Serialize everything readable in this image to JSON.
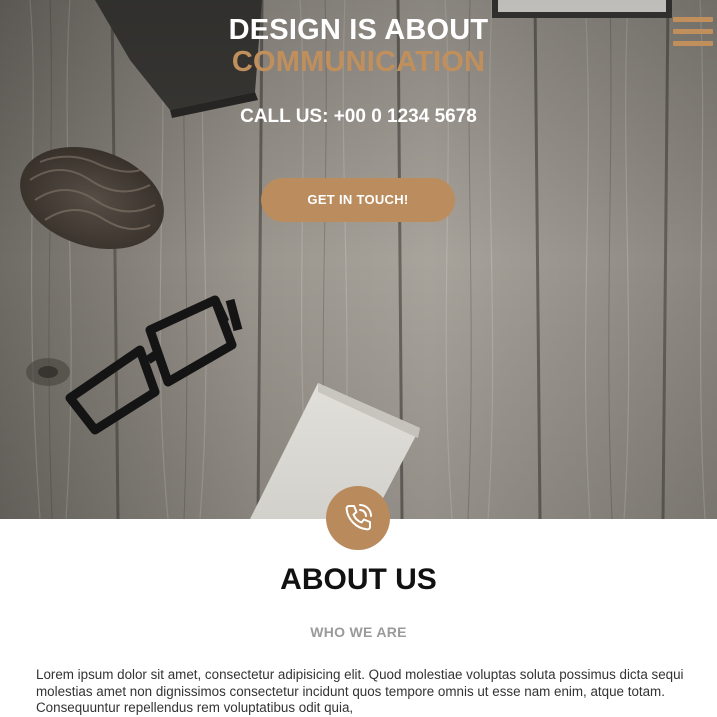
{
  "hero": {
    "title_line1": "DESIGN IS ABOUT",
    "title_line2": "COMMUNICATION",
    "phone": "CALL US: +00 0 1234 5678",
    "cta_label": "GET IN TOUCH!",
    "menu_icon": "hamburger-menu-icon",
    "accent_color": "#c18f5c"
  },
  "about": {
    "badge_icon": "phone-icon",
    "title": "ABOUT US",
    "subtitle": "WHO WE ARE",
    "body": "Lorem ipsum dolor sit amet, consectetur adipisicing elit. Quod molestiae voluptas soluta possimus dicta sequi molestias amet non dignissimos consectetur incidunt quos tempore omnis ut esse nam enim, atque totam. Consequuntur repellendus rem voluptatibus odit quia,"
  }
}
